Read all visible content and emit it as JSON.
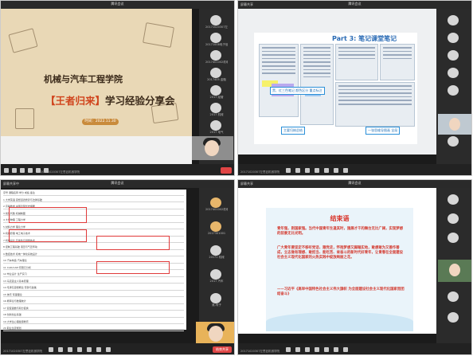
{
  "q1": {
    "meeting_title": "腾讯会议",
    "participants": [
      {
        "name": "20171020307左思钰机械学院"
      },
      {
        "name": "20171008电子信息"
      },
      {
        "name": "2017401002机电学院"
      },
      {
        "name": "2017405 金融"
      },
      {
        "name": "2017 经管"
      },
      {
        "name": "2017 机械"
      },
      {
        "name": "2017 电气"
      }
    ],
    "slide": {
      "school": "机械与汽车工程学院",
      "event_bracket_open": "【",
      "event_name": "王者归来",
      "event_bracket_close": "】",
      "event_suffix": "学习经验分享会",
      "date": "时间：2022.11.30"
    },
    "bottom_left": "20171020307左思钰机械学院"
  },
  "q2": {
    "meeting_title": "腾讯会议",
    "share_tag": "屏幕共享",
    "slide_title": "Part 3: 笔记课堂笔记",
    "annotations": [
      "黑、红三色笔记 颜色区分 重点标注",
      "主要归纳总结",
      "一张思维导图画 全局"
    ],
    "bottom_left": "20171020307左思钰机械学院"
  },
  "q3": {
    "share_tag": "屏幕共享中",
    "meeting_title": "腾讯会议",
    "participants": [
      {
        "name": "2017401002机电学院"
      },
      {
        "name": "2017301001"
      },
      {
        "name": "20171 机械"
      },
      {
        "name": "2017 汽车"
      },
      {
        "name": "吴-何子"
      }
    ],
    "table_rows": [
      "序号 课程名称 学分 成绩 备注",
      "1 大学英语 思想道德修养与法律基础",
      "2 高等数学 中国近现代史纲要",
      "3 线性代数 机械制图",
      "4 大学物理 工程力学",
      "5 材料力学 理论力学",
      "6 机械原理 电工电子技术",
      "7 机械设计 互换性与测量技术",
      "8 控制工程基础 液压与气压传动",
      "9 数控技术 机电一体化系统设计",
      "10 汽车构造 汽车理论",
      "11 CAD/CAM 有限元分析",
      "12 毕业设计 生产实习",
      "13 马克思主义基本原理",
      "14 毛泽东思想概论 形势与政策",
      "15 体育 军事理论",
      "16 概率论与数理统计",
      "17 复变函数与积分变换",
      "18 创新创业基础",
      "19 大学生心理健康教育",
      "20 职业生涯规划"
    ],
    "bottom_left": "20171020307左思钰机械学院",
    "red_button": "结束共享"
  },
  "q4": {
    "share_tag": "屏幕共享",
    "meeting_title": "腾讯会议",
    "slide": {
      "title": "结束语",
      "paragraph1": "青年强，则国家强。当代中国青年生逢其时，施展才干的舞台无比广阔，实现梦想的前景无比光明。",
      "paragraph2": "广大青年要坚定不移听党话、跟党走，怀抱梦想又脚踏实地，敢想敢为又善作善成，立志做有理想、敢担当、能吃苦、肯奋斗的新时代好青年，让青春在全面建设社会主义现代化国家的火热实践中绽放绚丽之花。",
      "quote": "——习近平《高举中国特色社会主义伟大旗帜 为全面建设社会主义现代化国家而团结奋斗》"
    },
    "bottom_left": "20171020307左思钰机械学院"
  }
}
